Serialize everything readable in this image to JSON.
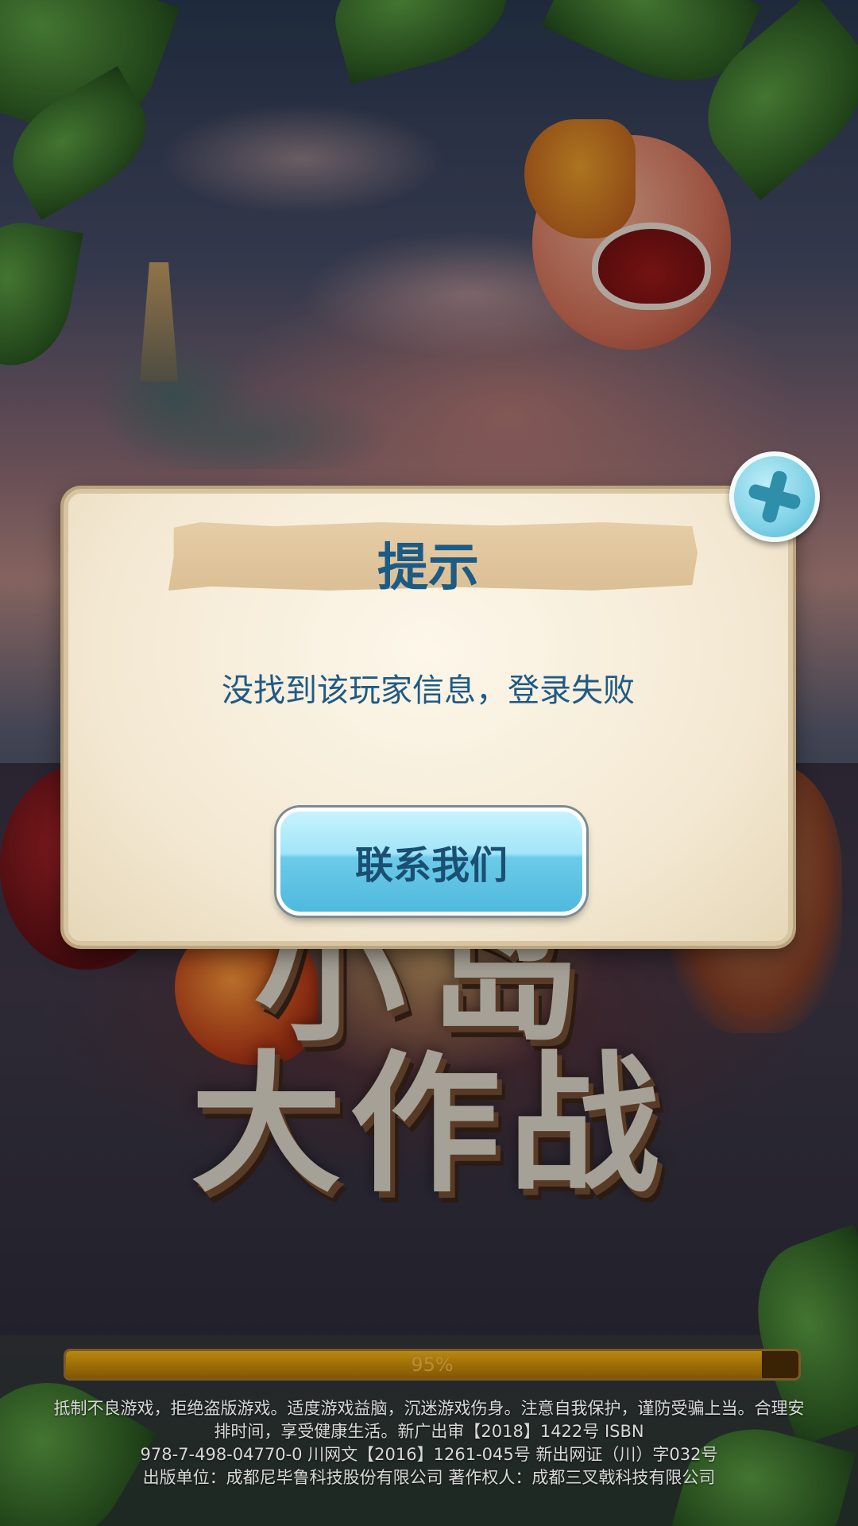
{
  "dialog": {
    "title": "提示",
    "message": "没找到该玩家信息，登录失败",
    "contact_button_label": "联系我们"
  },
  "game_logo": {
    "line1": "小岛",
    "line2": "大作战"
  },
  "progress": {
    "percent": 95,
    "label": "95%"
  },
  "footer": {
    "lines": [
      "抵制不良游戏，拒绝盗版游戏。适度游戏益脑，沉迷游戏伤身。注意自我保护，谨防受骗上当。合理安",
      "排时间，享受健康生活。新广出审【2018】1422号 ISBN",
      "978-7-498-04770-0 川网文【2016】1261-045号 新出网证（川）字032号",
      "出版单位：成都尼毕鲁科技股份有限公司 著作权人：成都三叉戟科技有限公司"
    ]
  },
  "icons": {
    "close": "close-icon"
  },
  "colors": {
    "title_text": "#1c5b84",
    "button_blue": "#6ccbe8",
    "progress_fill": "#9b6c06"
  }
}
